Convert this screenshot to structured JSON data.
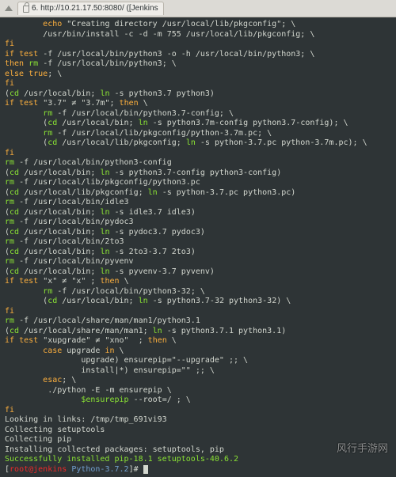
{
  "tab": {
    "index": "6.",
    "url": "http://10.21.17.50:8080/ ([Jenkins"
  },
  "terminal": {
    "lines": [
      {
        "i": 8,
        "segs": [
          {
            "c": "kw-echo",
            "t": "echo"
          },
          {
            "t": " \"Creating directory /usr/local/lib/pkgconfig\"; \\"
          }
        ]
      },
      {
        "i": 8,
        "segs": [
          {
            "t": "/usr/bin/install -c -d -m 755 /usr/local/lib/pkgconfig; \\"
          }
        ]
      },
      {
        "i": 0,
        "segs": [
          {
            "c": "kw-fi",
            "t": "fi"
          }
        ]
      },
      {
        "i": 0,
        "segs": [
          {
            "c": "kw-if",
            "t": "if"
          },
          {
            "t": " "
          },
          {
            "c": "kw-test",
            "t": "test"
          },
          {
            "t": " -f /usr/local/bin/python3 -o -h /usr/local/bin/python3; \\"
          }
        ]
      },
      {
        "i": 0,
        "segs": [
          {
            "c": "kw-then",
            "t": "then"
          },
          {
            "t": " "
          },
          {
            "c": "cmd",
            "t": "rm"
          },
          {
            "t": " -f /usr/local/bin/python3; \\"
          }
        ]
      },
      {
        "i": 0,
        "segs": [
          {
            "c": "kw-else",
            "t": "else"
          },
          {
            "t": " "
          },
          {
            "c": "kw-true",
            "t": "true"
          },
          {
            "t": "; \\"
          }
        ]
      },
      {
        "i": 0,
        "segs": [
          {
            "c": "kw-fi",
            "t": "fi"
          }
        ]
      },
      {
        "i": 0,
        "segs": [
          {
            "t": "("
          },
          {
            "c": "cmd",
            "t": "cd"
          },
          {
            "t": " /usr/local/bin; "
          },
          {
            "c": "cmd",
            "t": "ln"
          },
          {
            "t": " -s python3.7 python3)"
          }
        ]
      },
      {
        "i": 0,
        "segs": [
          {
            "c": "kw-if",
            "t": "if"
          },
          {
            "t": " "
          },
          {
            "c": "kw-test",
            "t": "test"
          },
          {
            "t": " \"3.7\" "
          },
          {
            "c": "neq",
            "t": "≠"
          },
          {
            "t": " \"3.7m\"; "
          },
          {
            "c": "kw-then",
            "t": "then"
          },
          {
            "t": " \\"
          }
        ]
      },
      {
        "i": 8,
        "segs": [
          {
            "c": "cmd",
            "t": "rm"
          },
          {
            "t": " -f /usr/local/bin/python3.7-config; \\"
          }
        ]
      },
      {
        "i": 8,
        "segs": [
          {
            "t": "("
          },
          {
            "c": "cmd",
            "t": "cd"
          },
          {
            "t": " /usr/local/bin; "
          },
          {
            "c": "cmd",
            "t": "ln"
          },
          {
            "t": " -s python3.7m-config python3.7-config); \\"
          }
        ]
      },
      {
        "i": 8,
        "segs": [
          {
            "c": "cmd",
            "t": "rm"
          },
          {
            "t": " -f /usr/local/lib/pkgconfig/python-3.7m.pc; \\"
          }
        ]
      },
      {
        "i": 8,
        "segs": [
          {
            "t": "("
          },
          {
            "c": "cmd",
            "t": "cd"
          },
          {
            "t": " /usr/local/lib/pkgconfig; "
          },
          {
            "c": "cmd",
            "t": "ln"
          },
          {
            "t": " -s python-3.7.pc python-3.7m.pc); \\"
          }
        ]
      },
      {
        "i": 0,
        "segs": [
          {
            "c": "kw-fi",
            "t": "fi"
          }
        ]
      },
      {
        "i": 0,
        "segs": [
          {
            "c": "cmd",
            "t": "rm"
          },
          {
            "t": " -f /usr/local/bin/python3-config"
          }
        ]
      },
      {
        "i": 0,
        "segs": [
          {
            "t": "("
          },
          {
            "c": "cmd",
            "t": "cd"
          },
          {
            "t": " /usr/local/bin; "
          },
          {
            "c": "cmd",
            "t": "ln"
          },
          {
            "t": " -s python3.7-config python3-config)"
          }
        ]
      },
      {
        "i": 0,
        "segs": [
          {
            "c": "cmd",
            "t": "rm"
          },
          {
            "t": " -f /usr/local/lib/pkgconfig/python3.pc"
          }
        ]
      },
      {
        "i": 0,
        "segs": [
          {
            "t": "("
          },
          {
            "c": "cmd",
            "t": "cd"
          },
          {
            "t": " /usr/local/lib/pkgconfig; "
          },
          {
            "c": "cmd",
            "t": "ln"
          },
          {
            "t": " -s python-3.7.pc python3.pc)"
          }
        ]
      },
      {
        "i": 0,
        "segs": [
          {
            "c": "cmd",
            "t": "rm"
          },
          {
            "t": " -f /usr/local/bin/idle3"
          }
        ]
      },
      {
        "i": 0,
        "segs": [
          {
            "t": "("
          },
          {
            "c": "cmd",
            "t": "cd"
          },
          {
            "t": " /usr/local/bin; "
          },
          {
            "c": "cmd",
            "t": "ln"
          },
          {
            "t": " -s idle3.7 idle3)"
          }
        ]
      },
      {
        "i": 0,
        "segs": [
          {
            "c": "cmd",
            "t": "rm"
          },
          {
            "t": " -f /usr/local/bin/pydoc3"
          }
        ]
      },
      {
        "i": 0,
        "segs": [
          {
            "t": "("
          },
          {
            "c": "cmd",
            "t": "cd"
          },
          {
            "t": " /usr/local/bin; "
          },
          {
            "c": "cmd",
            "t": "ln"
          },
          {
            "t": " -s pydoc3.7 pydoc3)"
          }
        ]
      },
      {
        "i": 0,
        "segs": [
          {
            "c": "cmd",
            "t": "rm"
          },
          {
            "t": " -f /usr/local/bin/2to3"
          }
        ]
      },
      {
        "i": 0,
        "segs": [
          {
            "t": "("
          },
          {
            "c": "cmd",
            "t": "cd"
          },
          {
            "t": " /usr/local/bin; "
          },
          {
            "c": "cmd",
            "t": "ln"
          },
          {
            "t": " -s 2to3-3.7 2to3)"
          }
        ]
      },
      {
        "i": 0,
        "segs": [
          {
            "c": "cmd",
            "t": "rm"
          },
          {
            "t": " -f /usr/local/bin/pyvenv"
          }
        ]
      },
      {
        "i": 0,
        "segs": [
          {
            "t": "("
          },
          {
            "c": "cmd",
            "t": "cd"
          },
          {
            "t": " /usr/local/bin; "
          },
          {
            "c": "cmd",
            "t": "ln"
          },
          {
            "t": " -s pyvenv-3.7 pyvenv)"
          }
        ]
      },
      {
        "i": 0,
        "segs": [
          {
            "c": "kw-if",
            "t": "if"
          },
          {
            "t": " "
          },
          {
            "c": "kw-test",
            "t": "test"
          },
          {
            "t": " \"x\" "
          },
          {
            "c": "neq",
            "t": "≠"
          },
          {
            "t": " \"x\" ; "
          },
          {
            "c": "kw-then",
            "t": "then"
          },
          {
            "t": " \\"
          }
        ]
      },
      {
        "i": 8,
        "segs": [
          {
            "c": "cmd",
            "t": "rm"
          },
          {
            "t": " -f /usr/local/bin/python3-32; \\"
          }
        ]
      },
      {
        "i": 8,
        "segs": [
          {
            "t": "("
          },
          {
            "c": "cmd",
            "t": "cd"
          },
          {
            "t": " /usr/local/bin; "
          },
          {
            "c": "cmd",
            "t": "ln"
          },
          {
            "t": " -s python3.7-32 python3-32) \\"
          }
        ]
      },
      {
        "i": 0,
        "segs": [
          {
            "c": "kw-fi",
            "t": "fi"
          }
        ]
      },
      {
        "i": 0,
        "segs": [
          {
            "c": "cmd",
            "t": "rm"
          },
          {
            "t": " -f /usr/local/share/man/man1/python3.1"
          }
        ]
      },
      {
        "i": 0,
        "segs": [
          {
            "t": "("
          },
          {
            "c": "cmd",
            "t": "cd"
          },
          {
            "t": " /usr/local/share/man/man1; "
          },
          {
            "c": "cmd",
            "t": "ln"
          },
          {
            "t": " -s python3.7.1 python3.1)"
          }
        ]
      },
      {
        "i": 0,
        "segs": [
          {
            "c": "kw-if",
            "t": "if"
          },
          {
            "t": " "
          },
          {
            "c": "kw-test",
            "t": "test"
          },
          {
            "t": " \"xupgrade\" "
          },
          {
            "c": "neq",
            "t": "≠"
          },
          {
            "t": " \"xno\"  ; "
          },
          {
            "c": "kw-then",
            "t": "then"
          },
          {
            "t": " \\"
          }
        ]
      },
      {
        "i": 8,
        "segs": [
          {
            "c": "kw-case",
            "t": "case"
          },
          {
            "t": " upgrade "
          },
          {
            "c": "kw-case",
            "t": "in"
          },
          {
            "t": " \\"
          }
        ]
      },
      {
        "i": 16,
        "segs": [
          {
            "t": "upgrade) ensurepip=\"--upgrade\" ;; \\"
          }
        ]
      },
      {
        "i": 16,
        "segs": [
          {
            "t": "install|*) ensurepip=\"\" ;; \\"
          }
        ]
      },
      {
        "i": 8,
        "segs": [
          {
            "c": "kw-esac",
            "t": "esac"
          },
          {
            "t": "; \\"
          }
        ]
      },
      {
        "i": 8,
        "segs": [
          {
            "t": " ./python -E -m ensurepip \\"
          }
        ]
      },
      {
        "i": 16,
        "segs": [
          {
            "c": "var",
            "t": "$ensurepip"
          },
          {
            "t": " --root=/ ; \\"
          }
        ]
      },
      {
        "i": 0,
        "segs": [
          {
            "c": "kw-fi",
            "t": "fi"
          }
        ]
      },
      {
        "i": 0,
        "segs": [
          {
            "t": "Looking in links: /tmp/tmp_691vi93"
          }
        ]
      },
      {
        "i": 0,
        "segs": [
          {
            "t": "Collecting setuptools"
          }
        ]
      },
      {
        "i": 0,
        "segs": [
          {
            "t": "Collecting pip"
          }
        ]
      },
      {
        "i": 0,
        "segs": [
          {
            "t": "Installing collected packages: setuptools, pip"
          }
        ]
      },
      {
        "i": 0,
        "segs": [
          {
            "c": "success",
            "t": "Successfully installed pip-18.1 setuptools-40.6.2"
          }
        ]
      }
    ],
    "prompt": {
      "user": "root@jenkins",
      "dir": "Python-3.7.2",
      "end": "]# "
    }
  },
  "watermark": "风行手游网"
}
